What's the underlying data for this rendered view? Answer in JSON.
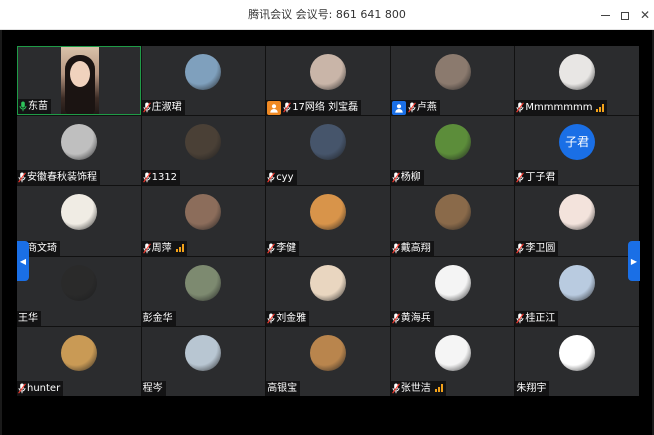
{
  "window": {
    "title": "腾讯会议 会议号: 861 641 800",
    "minimize_icon": "minimize-icon",
    "maximize_icon": "maximize-icon",
    "close_glyph": "✕"
  },
  "colors": {
    "tile_bg": "#2b2c2e",
    "active_border": "#1f9b47",
    "signal": "#f3a21a",
    "accent": "#1a6fe6",
    "mic_active": "#2ec45b",
    "mic_muted": "#ff3b30"
  },
  "pager": {
    "left_glyph": "◀",
    "right_glyph": "▶"
  },
  "participants": [
    {
      "name": "东苗",
      "mic": "active",
      "video": true,
      "active": true
    },
    {
      "name": "庄淑珺",
      "mic": "muted",
      "avatar_color": "#7fa0bd"
    },
    {
      "name": "17网络 刘宝磊",
      "mic": "muted",
      "badge": "host",
      "avatar_color": "#c9b5a8"
    },
    {
      "name": "卢燕",
      "mic": "muted",
      "badge": "cohost",
      "avatar_color": "#8b7a6e"
    },
    {
      "name": "Mmmmmmm",
      "mic": "muted",
      "signal": true,
      "avatar_color": "#e8e6e4"
    },
    {
      "name": "安徽春秋装饰程",
      "mic": "muted",
      "avatar_color": "#bfbfbf"
    },
    {
      "name": "1312",
      "mic": "muted",
      "avatar_color": "#4a4036"
    },
    {
      "name": "cyy",
      "mic": "muted",
      "avatar_color": "#46556b"
    },
    {
      "name": "杨柳",
      "mic": "muted",
      "avatar_color": "#5c8d3a"
    },
    {
      "name": "丁子君",
      "mic": "muted",
      "avatar_text": "子君"
    },
    {
      "name": "商文琦",
      "mic": "muted",
      "avatar_color": "#f0ece4"
    },
    {
      "name": "周萍",
      "mic": "muted",
      "signal": true,
      "avatar_color": "#8c6d5b"
    },
    {
      "name": "李健",
      "mic": "muted",
      "avatar_color": "#d8944a"
    },
    {
      "name": "戴高翔",
      "mic": "muted",
      "avatar_color": "#8a6a4a"
    },
    {
      "name": "李卫圆",
      "mic": "muted",
      "avatar_color": "#f3e3dc"
    },
    {
      "name": "王华",
      "mic": "none",
      "avatar_color": "#2a2a2a"
    },
    {
      "name": "彭金华",
      "mic": "none",
      "avatar_color": "#7d8a70"
    },
    {
      "name": "刘金雅",
      "mic": "muted",
      "avatar_color": "#e9d6c0"
    },
    {
      "name": "黄海兵",
      "mic": "muted",
      "avatar_color": "#f4f4f4"
    },
    {
      "name": "桂正江",
      "mic": "muted",
      "avatar_color": "#b9cbe0"
    },
    {
      "name": "hunter",
      "mic": "muted",
      "avatar_color": "#c99a55"
    },
    {
      "name": "程岑",
      "mic": "none",
      "avatar_color": "#b8c6d2"
    },
    {
      "name": "高银宝",
      "mic": "none",
      "avatar_color": "#b9854d"
    },
    {
      "name": "张世洁",
      "mic": "muted",
      "signal": true,
      "avatar_color": "#f5f5f5"
    },
    {
      "name": "朱翔宇",
      "mic": "none",
      "avatar_color": "#ffffff"
    }
  ]
}
